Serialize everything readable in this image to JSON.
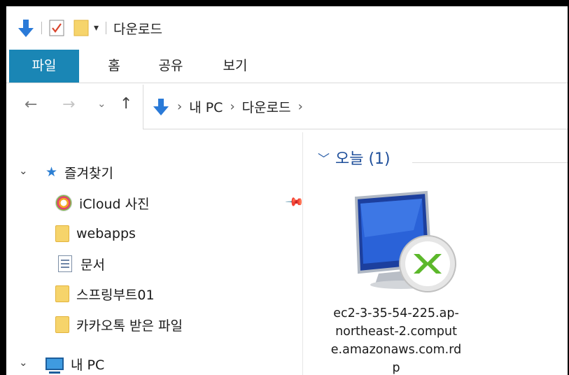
{
  "window": {
    "title": "다운로드",
    "qat_icons": [
      "download-arrow-icon",
      "properties-icon",
      "new-folder-icon",
      "customize-dropdown-icon"
    ]
  },
  "ribbon": {
    "tabs": [
      {
        "label": "파일",
        "active": true
      },
      {
        "label": "홈"
      },
      {
        "label": "공유"
      },
      {
        "label": "보기"
      }
    ],
    "accent": "#1a86b5"
  },
  "navigation": {
    "back_icon": "arrow-left-icon",
    "forward_icon": "arrow-right-icon",
    "recent_icon": "chevron-down-icon",
    "up_icon": "arrow-up-icon"
  },
  "address": {
    "crumbs": [
      "내 PC",
      "다운로드"
    ]
  },
  "sidebar": {
    "quick_access": "즐겨찾기",
    "items": [
      {
        "label": "iCloud 사진",
        "icon": "photos-icon",
        "pinned": true
      },
      {
        "label": "webapps",
        "icon": "folder-icon"
      },
      {
        "label": "문서",
        "icon": "document-icon"
      },
      {
        "label": "스프링부트01",
        "icon": "folder-icon"
      },
      {
        "label": "카카오톡 받은 파일",
        "icon": "folder-icon"
      }
    ],
    "this_pc": "내 PC"
  },
  "content": {
    "group_label": "오늘 (1)",
    "files": [
      {
        "name": "ec2-3-35-54-225.ap-northeast-2.compute.amazonaws.com.rdp",
        "icon": "remote-desktop-icon"
      }
    ],
    "group_color": "#1e4e9a"
  }
}
